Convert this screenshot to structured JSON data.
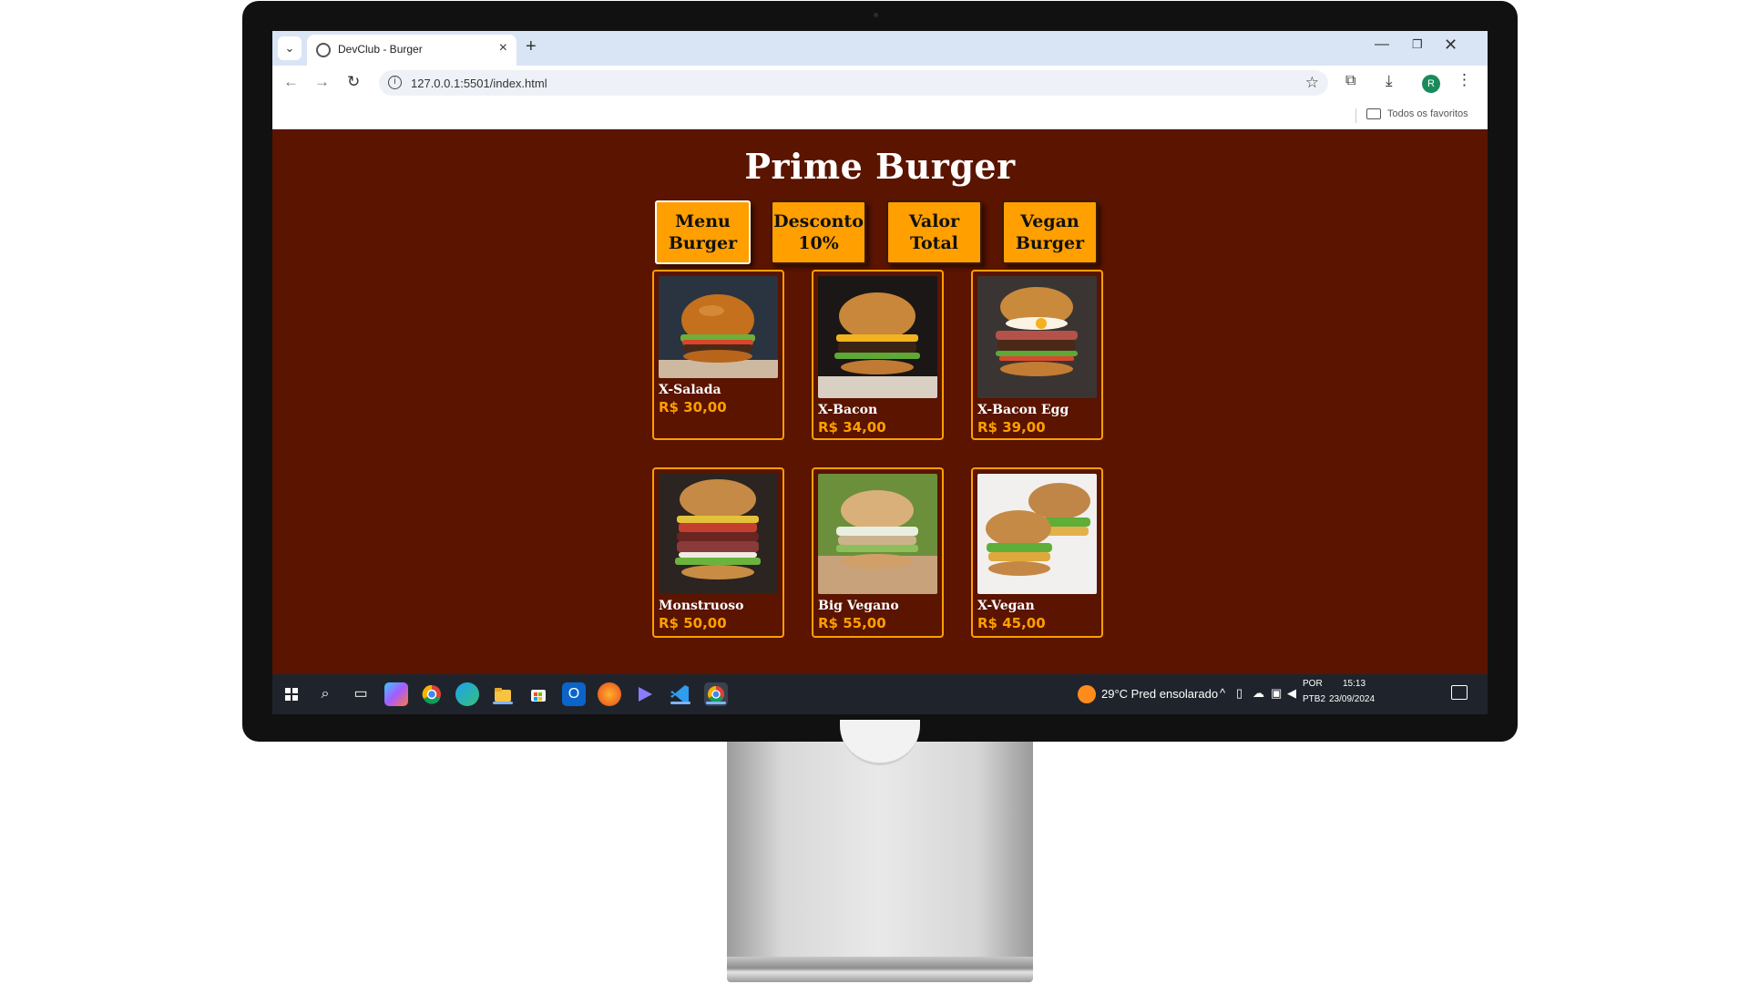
{
  "browser": {
    "tab_title": "DevClub - Burger",
    "url": "127.0.0.1:5501/index.html",
    "bookmarks_all": "Todos os favoritos",
    "profile_initial": "R"
  },
  "page": {
    "title": "Prime Burger",
    "buttons": [
      {
        "line1": "Menu",
        "line2": "Burger"
      },
      {
        "line1": "Desconto",
        "line2": "10%"
      },
      {
        "line1": "Valor",
        "line2": "Total"
      },
      {
        "line1": "Vegan",
        "line2": "Burger"
      }
    ],
    "products": [
      {
        "name": "X-Salada",
        "price": "R$ 30,00"
      },
      {
        "name": "X-Bacon",
        "price": "R$ 34,00"
      },
      {
        "name": "X-Bacon Egg",
        "price": "R$ 39,00"
      },
      {
        "name": "Monstruoso",
        "price": "R$ 50,00"
      },
      {
        "name": "Big Vegano",
        "price": "R$ 55,00"
      },
      {
        "name": "X-Vegan",
        "price": "R$ 45,00"
      }
    ]
  },
  "taskbar": {
    "weather": "29°C  Pred ensolarado",
    "lang_1": "POR",
    "lang_2": "PTB2",
    "time": "15:13",
    "date": "23/09/2024"
  },
  "colors": {
    "page_background": "#5a1400",
    "accent": "#ff9f00",
    "tabbar": "#d9e5f5",
    "taskbar": "#1f242c"
  }
}
